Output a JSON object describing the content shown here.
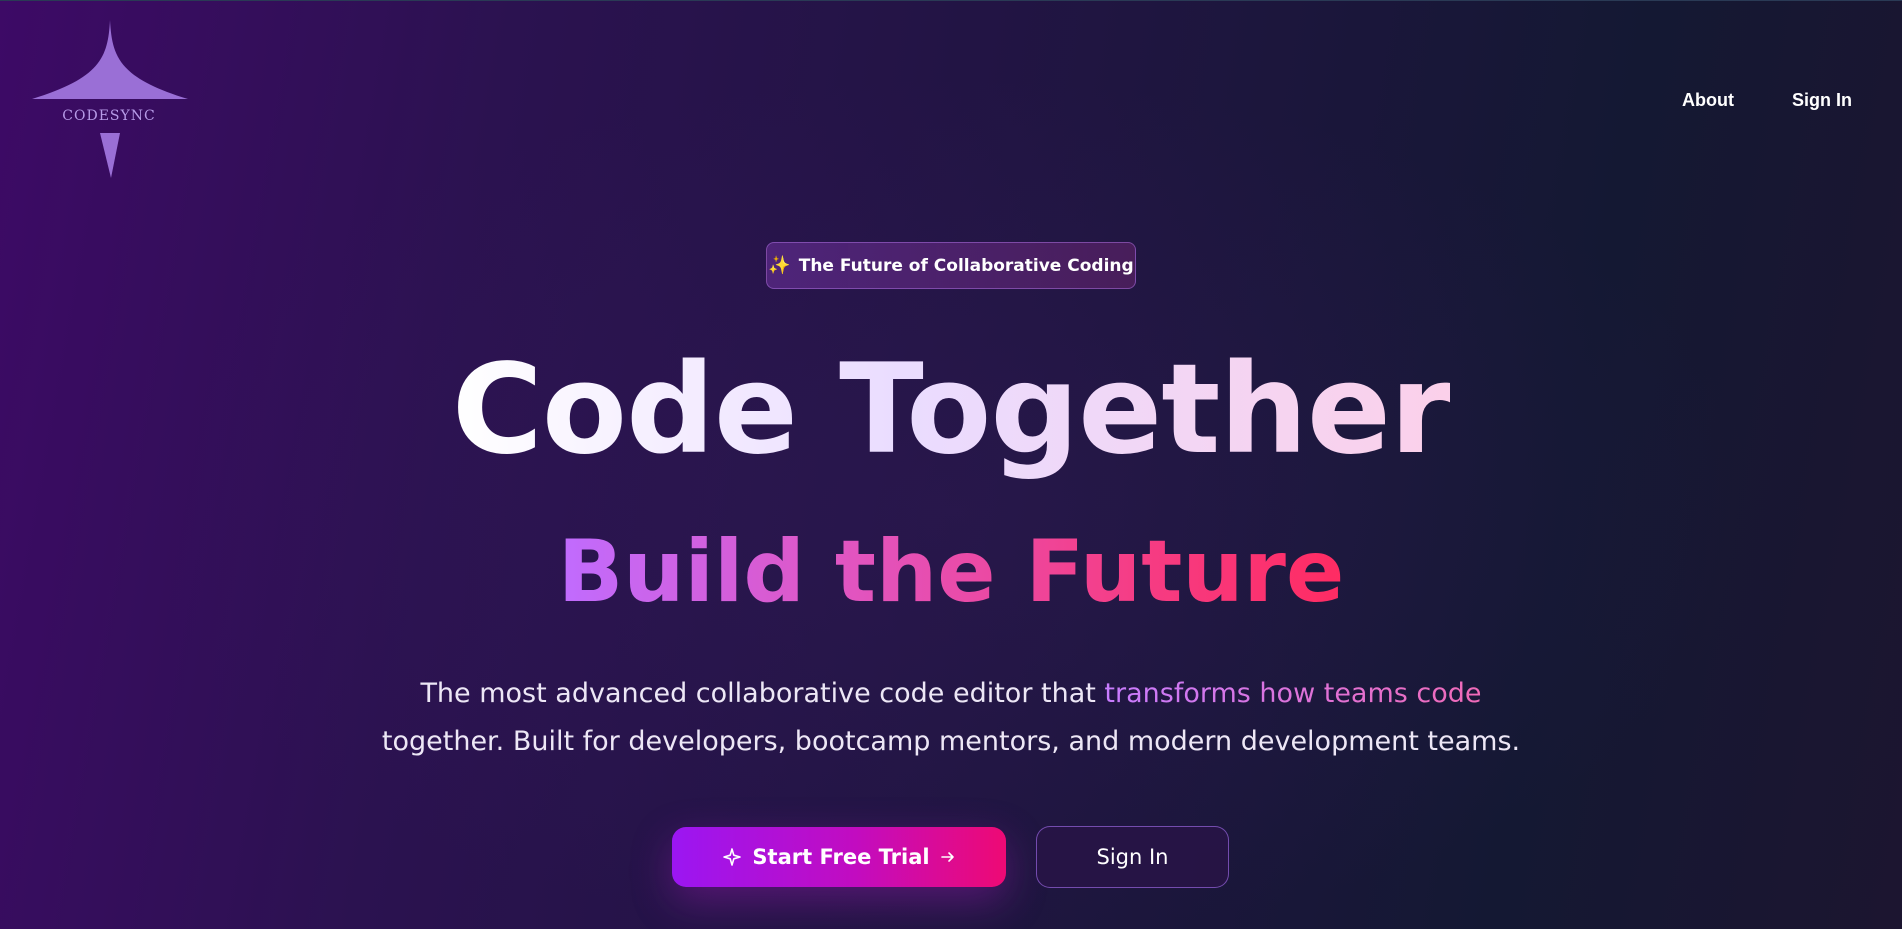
{
  "header": {
    "logo_text": "CODESYNC",
    "nav": [
      {
        "label": "About"
      },
      {
        "label": "Sign In"
      }
    ]
  },
  "badge": {
    "icon": "sparkles-icon",
    "text": "The Future of Collaborative Coding"
  },
  "hero": {
    "title": "Code Together",
    "subtitle": "Build the Future",
    "description_before": "The most advanced collaborative code editor that ",
    "description_highlight": "transforms how teams code",
    "description_after": "together. Built for developers, bootcamp mentors, and modern development teams."
  },
  "actions": {
    "primary_label": "Start Free Trial",
    "primary_icons": [
      "sparkle-icon",
      "arrow-right-icon"
    ],
    "secondary_label": "Sign In"
  },
  "colors": {
    "accent_purple": "#9b16f2",
    "accent_pink": "#ee0a74",
    "logo_purple": "#9a6fd6"
  }
}
